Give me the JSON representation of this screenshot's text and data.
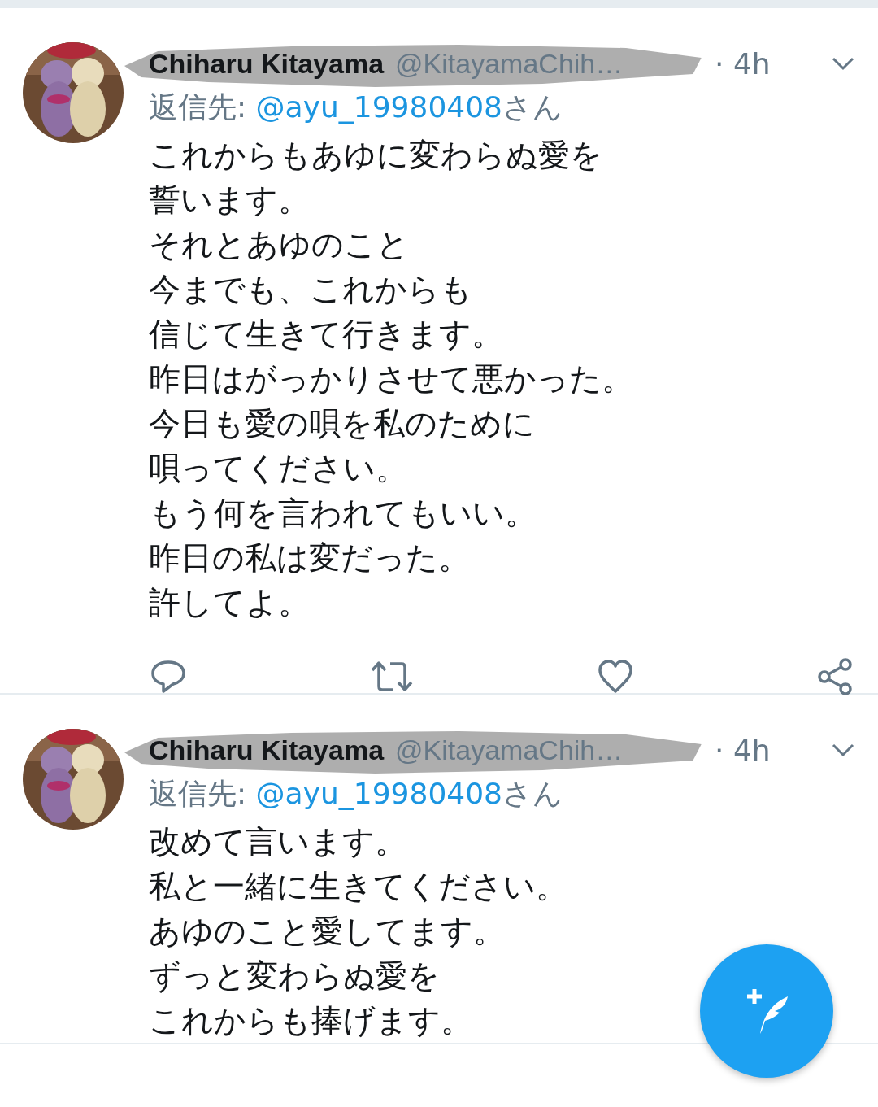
{
  "tweets": [
    {
      "name": "Chiharu Kitayama",
      "handle": "@KitayamaChih…",
      "time": "· 4h",
      "reply_label": "返信先:",
      "reply_to": "@ayu_19980408",
      "reply_suffix": "さん",
      "lines": [
        "これからもあゆに変わらぬ愛を",
        "誓います。",
        "それとあゆのこと",
        "今までも、これからも",
        "信じて生きて行きます。",
        "昨日はがっかりさせて悪かった。",
        "今日も愛の唄を私のために",
        "唄ってください。",
        "もう何を言われてもいい。",
        "昨日の私は変だった。",
        "許してよ。"
      ],
      "actions": [
        {
          "kind": "reply"
        },
        {
          "kind": "retweet"
        },
        {
          "kind": "like"
        },
        {
          "kind": "share"
        }
      ]
    },
    {
      "name": "Chiharu Kitayama",
      "handle": "@KitayamaChih…",
      "time": "· 4h",
      "reply_label": "返信先:",
      "reply_to": "@ayu_19980408",
      "reply_suffix": "さん",
      "lines": [
        "改めて言います。",
        "私と一緒に生きてください。",
        "あゆのこと愛してます。",
        "ずっと変わらぬ愛を",
        "これからも捧げます。"
      ]
    }
  ]
}
